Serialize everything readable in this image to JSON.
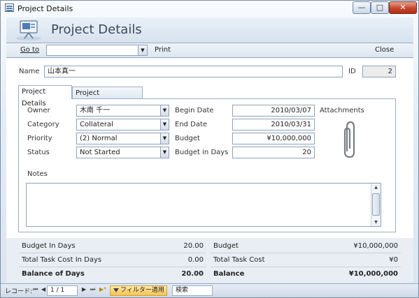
{
  "window": {
    "title": "Project Details",
    "min": "—",
    "max": "□",
    "close": "✕"
  },
  "header": {
    "title": "Project Details"
  },
  "nav": {
    "goto_label": "Go to",
    "goto_value": "",
    "print_label": "Print",
    "close_label": "Close"
  },
  "record": {
    "name_label": "Name",
    "name_value": "山本真一",
    "id_label": "ID",
    "id_value": "2"
  },
  "tabs": [
    {
      "label": "Project Details",
      "active": true
    },
    {
      "label": "Project Deliverables",
      "active": false
    }
  ],
  "details": {
    "owner_label": "Owner",
    "owner_value": "木南 千一",
    "category_label": "Category",
    "category_value": "Collateral",
    "priority_label": "Priority",
    "priority_value": "(2) Normal",
    "status_label": "Status",
    "status_value": "Not Started",
    "begin_label": "Begin Date",
    "begin_value": "2010/03/07",
    "end_label": "End Date",
    "end_value": "2010/03/31",
    "budget_label": "Budget",
    "budget_value": "¥10,000,000",
    "budget_days_label": "Budget in Days",
    "budget_days_value": "20",
    "attachments_label": "Attachments",
    "notes_label": "Notes",
    "notes_value": ""
  },
  "summary": {
    "left": [
      {
        "label": "Budget In Days",
        "value": "20.00",
        "bold": false
      },
      {
        "label": "Total Task Cost In Days",
        "value": "0.00",
        "bold": false
      },
      {
        "label": "Balance of Days",
        "value": "20.00",
        "bold": true
      }
    ],
    "right": [
      {
        "label": "Budget",
        "value": "¥10,000,000",
        "bold": false
      },
      {
        "label": "Total Task Cost",
        "value": "¥0",
        "bold": false
      },
      {
        "label": "Balance",
        "value": "¥10,000,000",
        "bold": true
      }
    ]
  },
  "statusbar": {
    "record_label": "レコード:",
    "first": "⏮",
    "prev": "◀",
    "record_pos": "1 / 1",
    "next": "▶",
    "last": "⏭",
    "new": "▶*",
    "filter_label": "フィルター適用",
    "search_label": "検索"
  }
}
